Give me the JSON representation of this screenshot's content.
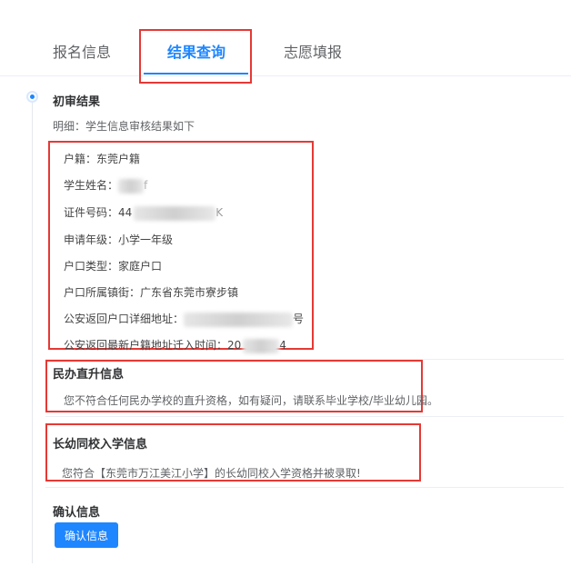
{
  "tabs": [
    {
      "label": "报名信息"
    },
    {
      "label": "结果查询"
    },
    {
      "label": "志愿填报"
    }
  ],
  "first_review": {
    "title": "初审结果",
    "subtitle": "明细：学生信息审核结果如下",
    "rows": [
      {
        "label": "户籍：",
        "value": "东莞户籍"
      },
      {
        "label": "学生姓名：",
        "value": "",
        "tail": "f"
      },
      {
        "label": "证件号码：",
        "value": "44",
        "tail": "K"
      },
      {
        "label": "申请年级：",
        "value": "小学一年级"
      },
      {
        "label": "户口类型：",
        "value": "家庭户口"
      },
      {
        "label": "户口所属镇街：",
        "value": "广东省东莞市寮步镇"
      },
      {
        "label": "公安返回户口详细地址：",
        "value": "",
        "tail": "号"
      },
      {
        "label": "公安返回最新户籍地址迁入时间：",
        "value": "20",
        "tail": "4"
      }
    ]
  },
  "private_direct": {
    "title": "民办直升信息",
    "text": "您不符合任何民办学校的直升资格，如有疑问，请联系毕业学校/毕业幼儿园。"
  },
  "kindergarten_enroll": {
    "title": "长幼同校入学信息",
    "text": "您符合【东莞市万江美江小学】的长幼同校入学资格并被录取!"
  },
  "confirm": {
    "title": "确认信息",
    "button_label": "确认信息"
  },
  "colors": {
    "accent": "#1e86ff",
    "highlight_box": "#e53935"
  }
}
